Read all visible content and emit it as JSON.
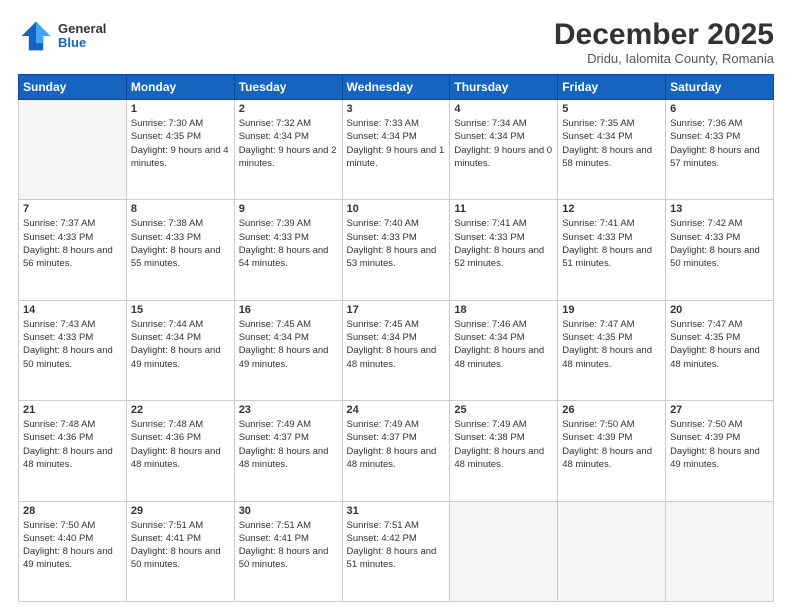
{
  "header": {
    "logo": {
      "general": "General",
      "blue": "Blue"
    },
    "title": "December 2025",
    "subtitle": "Dridu, Ialomita County, Romania"
  },
  "weekdays": [
    "Sunday",
    "Monday",
    "Tuesday",
    "Wednesday",
    "Thursday",
    "Friday",
    "Saturday"
  ],
  "weeks": [
    [
      {
        "day": null
      },
      {
        "day": 1,
        "sunrise": "7:30 AM",
        "sunset": "4:35 PM",
        "daylight": "9 hours and 4 minutes."
      },
      {
        "day": 2,
        "sunrise": "7:32 AM",
        "sunset": "4:34 PM",
        "daylight": "9 hours and 2 minutes."
      },
      {
        "day": 3,
        "sunrise": "7:33 AM",
        "sunset": "4:34 PM",
        "daylight": "9 hours and 1 minute."
      },
      {
        "day": 4,
        "sunrise": "7:34 AM",
        "sunset": "4:34 PM",
        "daylight": "9 hours and 0 minutes."
      },
      {
        "day": 5,
        "sunrise": "7:35 AM",
        "sunset": "4:34 PM",
        "daylight": "8 hours and 58 minutes."
      },
      {
        "day": 6,
        "sunrise": "7:36 AM",
        "sunset": "4:33 PM",
        "daylight": "8 hours and 57 minutes."
      }
    ],
    [
      {
        "day": 7,
        "sunrise": "7:37 AM",
        "sunset": "4:33 PM",
        "daylight": "8 hours and 56 minutes."
      },
      {
        "day": 8,
        "sunrise": "7:38 AM",
        "sunset": "4:33 PM",
        "daylight": "8 hours and 55 minutes."
      },
      {
        "day": 9,
        "sunrise": "7:39 AM",
        "sunset": "4:33 PM",
        "daylight": "8 hours and 54 minutes."
      },
      {
        "day": 10,
        "sunrise": "7:40 AM",
        "sunset": "4:33 PM",
        "daylight": "8 hours and 53 minutes."
      },
      {
        "day": 11,
        "sunrise": "7:41 AM",
        "sunset": "4:33 PM",
        "daylight": "8 hours and 52 minutes."
      },
      {
        "day": 12,
        "sunrise": "7:41 AM",
        "sunset": "4:33 PM",
        "daylight": "8 hours and 51 minutes."
      },
      {
        "day": 13,
        "sunrise": "7:42 AM",
        "sunset": "4:33 PM",
        "daylight": "8 hours and 50 minutes."
      }
    ],
    [
      {
        "day": 14,
        "sunrise": "7:43 AM",
        "sunset": "4:33 PM",
        "daylight": "8 hours and 50 minutes."
      },
      {
        "day": 15,
        "sunrise": "7:44 AM",
        "sunset": "4:34 PM",
        "daylight": "8 hours and 49 minutes."
      },
      {
        "day": 16,
        "sunrise": "7:45 AM",
        "sunset": "4:34 PM",
        "daylight": "8 hours and 49 minutes."
      },
      {
        "day": 17,
        "sunrise": "7:45 AM",
        "sunset": "4:34 PM",
        "daylight": "8 hours and 48 minutes."
      },
      {
        "day": 18,
        "sunrise": "7:46 AM",
        "sunset": "4:34 PM",
        "daylight": "8 hours and 48 minutes."
      },
      {
        "day": 19,
        "sunrise": "7:47 AM",
        "sunset": "4:35 PM",
        "daylight": "8 hours and 48 minutes."
      },
      {
        "day": 20,
        "sunrise": "7:47 AM",
        "sunset": "4:35 PM",
        "daylight": "8 hours and 48 minutes."
      }
    ],
    [
      {
        "day": 21,
        "sunrise": "7:48 AM",
        "sunset": "4:36 PM",
        "daylight": "8 hours and 48 minutes."
      },
      {
        "day": 22,
        "sunrise": "7:48 AM",
        "sunset": "4:36 PM",
        "daylight": "8 hours and 48 minutes."
      },
      {
        "day": 23,
        "sunrise": "7:49 AM",
        "sunset": "4:37 PM",
        "daylight": "8 hours and 48 minutes."
      },
      {
        "day": 24,
        "sunrise": "7:49 AM",
        "sunset": "4:37 PM",
        "daylight": "8 hours and 48 minutes."
      },
      {
        "day": 25,
        "sunrise": "7:49 AM",
        "sunset": "4:38 PM",
        "daylight": "8 hours and 48 minutes."
      },
      {
        "day": 26,
        "sunrise": "7:50 AM",
        "sunset": "4:39 PM",
        "daylight": "8 hours and 48 minutes."
      },
      {
        "day": 27,
        "sunrise": "7:50 AM",
        "sunset": "4:39 PM",
        "daylight": "8 hours and 49 minutes."
      }
    ],
    [
      {
        "day": 28,
        "sunrise": "7:50 AM",
        "sunset": "4:40 PM",
        "daylight": "8 hours and 49 minutes."
      },
      {
        "day": 29,
        "sunrise": "7:51 AM",
        "sunset": "4:41 PM",
        "daylight": "8 hours and 50 minutes."
      },
      {
        "day": 30,
        "sunrise": "7:51 AM",
        "sunset": "4:41 PM",
        "daylight": "8 hours and 50 minutes."
      },
      {
        "day": 31,
        "sunrise": "7:51 AM",
        "sunset": "4:42 PM",
        "daylight": "8 hours and 51 minutes."
      },
      {
        "day": null
      },
      {
        "day": null
      },
      {
        "day": null
      }
    ]
  ]
}
